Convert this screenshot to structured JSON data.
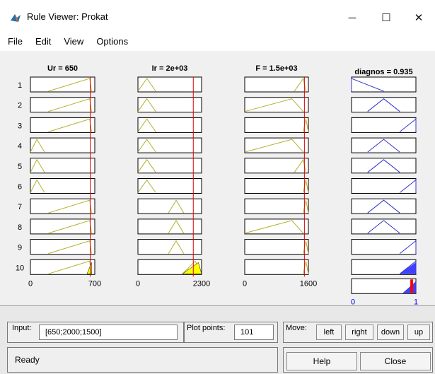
{
  "window": {
    "title": "Rule Viewer: Prokat",
    "minimize_glyph": "─",
    "maximize_glyph": "☐",
    "close_glyph": "✕"
  },
  "menu": {
    "items": [
      "File",
      "Edit",
      "View",
      "Options"
    ]
  },
  "plot": {
    "inputs": [
      {
        "title": "Ur = 650",
        "range": [
          0,
          700
        ],
        "tick_labels": [
          "0",
          "700"
        ],
        "value": 650
      },
      {
        "title": "Ir = 2e+03",
        "range": [
          0,
          2300
        ],
        "tick_labels": [
          "0",
          "2300"
        ],
        "value": 2000
      },
      {
        "title": "F = 1.5e+03",
        "range": [
          0,
          1600
        ],
        "tick_labels": [
          "0",
          "1600"
        ],
        "value": 1500
      }
    ],
    "output": {
      "title": "diagnos = 0.935",
      "range": [
        0,
        1
      ],
      "tick_labels": [
        "0",
        "1"
      ],
      "value": 0.935
    },
    "rule_numbers": [
      "1",
      "2",
      "3",
      "4",
      "5",
      "6",
      "7",
      "8",
      "9",
      "10"
    ],
    "colors": {
      "input_mf": "#b5b02e",
      "output_mf": "#3333cc",
      "fill_input": "#ffff00",
      "fill_output": "#4040ff",
      "index_line": "#e00000",
      "aggregate_marker": "#ff0000",
      "output_tick_label": "#0000ff"
    }
  },
  "bottom": {
    "input_label": "Input:",
    "input_value": "[650;2000;1500]",
    "plot_points_label": "Plot points:",
    "plot_points_value": "101",
    "move_label": "Move:",
    "move_buttons": [
      "left",
      "right",
      "down",
      "up"
    ],
    "status": "Ready",
    "help_label": "Help",
    "close_label": "Close"
  }
}
